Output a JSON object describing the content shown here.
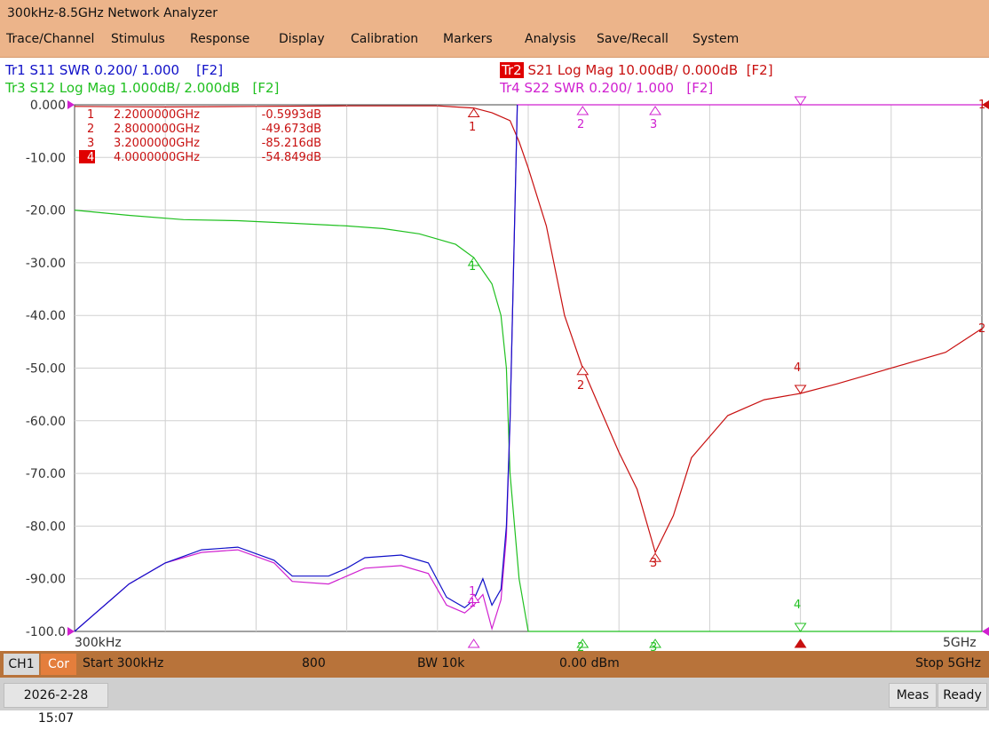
{
  "app": {
    "title": "300kHz-8.5GHz Network Analyzer"
  },
  "menu": [
    "Trace/Channel",
    "Stimulus",
    "Response",
    "Display",
    "Calibration",
    "Markers",
    "Analysis",
    "Save/Recall",
    "System"
  ],
  "traces": {
    "tr1": {
      "id": "Tr1",
      "desc": "S11 SWR 0.200/ 1.000",
      "fkey": "[F2]",
      "color": "#1010c8"
    },
    "tr2": {
      "id": "Tr2",
      "desc": "S21 Log Mag 10.00dB/ 0.000dB",
      "fkey": "[F2]",
      "color": "#c81010"
    },
    "tr3": {
      "id": "Tr3",
      "desc": "S12 Log Mag 1.000dB/ 2.000dB",
      "fkey": "[F2]",
      "color": "#20c020"
    },
    "tr4": {
      "id": "Tr4",
      "desc": "S22 SWR 0.200/ 1.000",
      "fkey": "[F2]",
      "color": "#d020d0"
    }
  },
  "markers_table": [
    {
      "num": "1",
      "freq": "2.2000000GHz",
      "value": "-0.5993dB"
    },
    {
      "num": "2",
      "freq": "2.8000000GHz",
      "value": "-49.673dB"
    },
    {
      "num": "3",
      "freq": "3.2000000GHz",
      "value": "-85.216dB"
    },
    {
      "num": "4",
      "freq": "4.0000000GHz",
      "value": "-54.849dB"
    }
  ],
  "marker_labels": {
    "m1": "1",
    "m2": "2",
    "m3": "3",
    "m4": "4"
  },
  "axis": {
    "y_ticks": [
      "0.000",
      "-10.00",
      "-20.00",
      "-30.00",
      "-40.00",
      "-50.00",
      "-60.00",
      "-70.00",
      "-80.00",
      "-90.00",
      "-100.0"
    ],
    "x_start": "300kHz",
    "x_stop": "5GHz"
  },
  "chart_data": {
    "type": "line",
    "ylim": [
      -100,
      0
    ],
    "xlim_ghz": [
      0.0003,
      5
    ],
    "series": [
      {
        "name": "S11",
        "color": "#1010c8",
        "x": [
          0.0003,
          0.1,
          0.3,
          0.5,
          0.7,
          0.9,
          1.1,
          1.2,
          1.4,
          1.5,
          1.6,
          1.8,
          1.95,
          2.05,
          2.15,
          2.2,
          2.25,
          2.3,
          2.35,
          2.38,
          2.4,
          2.42,
          2.44
        ],
        "y": [
          -100,
          -97,
          -91,
          -87,
          -84.5,
          -84,
          -86.5,
          -89.5,
          -89.5,
          -88,
          -86,
          -85.5,
          -87,
          -93.5,
          -95.5,
          -94,
          -90,
          -95,
          -92,
          -80,
          -60,
          -30,
          0
        ]
      },
      {
        "name": "S21",
        "color": "#c81010",
        "x": [
          0.0003,
          0.5,
          1.0,
          1.5,
          2.0,
          2.2,
          2.3,
          2.4,
          2.45,
          2.5,
          2.6,
          2.7,
          2.8,
          2.9,
          3.0,
          3.1,
          3.2,
          3.3,
          3.4,
          3.6,
          3.8,
          4.0,
          4.2,
          4.4,
          4.6,
          4.8,
          5.0
        ],
        "y": [
          -0.3,
          -0.4,
          -0.3,
          -0.2,
          -0.2,
          -0.6,
          -1.5,
          -3,
          -7,
          -12,
          -23,
          -40,
          -50,
          -58,
          -66,
          -73,
          -85,
          -78,
          -67,
          -59,
          -56,
          -54.8,
          -53,
          -51,
          -49,
          -47,
          -42.5
        ]
      },
      {
        "name": "S12",
        "color": "#20c020",
        "x": [
          0.0003,
          0.3,
          0.6,
          0.9,
          1.2,
          1.5,
          1.7,
          1.9,
          2.0,
          2.1,
          2.2,
          2.3,
          2.35,
          2.38,
          2.4,
          2.45,
          2.5,
          2.55,
          5.0
        ],
        "y": [
          -20,
          -21,
          -21.8,
          -22,
          -22.5,
          -23,
          -23.5,
          -24.5,
          -25.5,
          -26.5,
          -29,
          -34,
          -40,
          -50,
          -70,
          -90,
          -100,
          -100,
          -100
        ]
      },
      {
        "name": "S22",
        "color": "#d020d0",
        "x": [
          0.0003,
          0.1,
          0.3,
          0.5,
          0.7,
          0.9,
          1.1,
          1.2,
          1.4,
          1.5,
          1.6,
          1.8,
          1.95,
          2.05,
          2.15,
          2.2,
          2.25,
          2.3,
          2.35,
          2.38,
          2.4,
          2.42,
          2.44,
          2.45,
          5.0
        ],
        "y": [
          -100,
          -97,
          -91,
          -87,
          -85,
          -84.5,
          -87,
          -90.5,
          -91,
          -89.5,
          -88,
          -87.5,
          -89,
          -95,
          -96.5,
          -95,
          -93,
          -99.5,
          -94,
          -82,
          -60,
          -30,
          0,
          0,
          0
        ]
      }
    ]
  },
  "status": {
    "ch": "CH1",
    "cor": "Cor",
    "start": "Start 300kHz",
    "points": "800",
    "bw": "BW 10k",
    "power": "0.00 dBm",
    "stop": "Stop 5GHz"
  },
  "footer": {
    "datetime": "2026-2-28 15:07",
    "meas": "Meas",
    "ready": "Ready"
  }
}
